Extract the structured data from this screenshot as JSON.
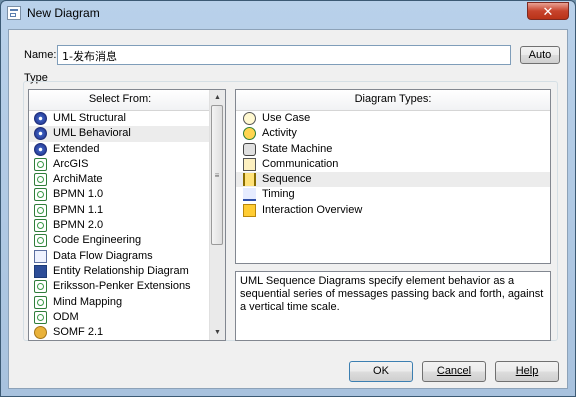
{
  "window": {
    "title": "New Diagram",
    "close_label": "✕"
  },
  "name_field": {
    "label": "Name:",
    "value": "1-发布消息"
  },
  "buttons": {
    "auto": "Auto",
    "ok": "OK",
    "cancel": "Cancel",
    "help": "Help"
  },
  "type_group": {
    "label": "Type"
  },
  "select_from": {
    "header": "Select From:",
    "selected_index": 1,
    "items": [
      {
        "label": "UML Structural",
        "icon": "uml-icon"
      },
      {
        "label": "UML Behavioral",
        "icon": "uml-icon"
      },
      {
        "label": "Extended",
        "icon": "uml-icon"
      },
      {
        "label": "ArcGIS",
        "icon": "technology-icon"
      },
      {
        "label": "ArchiMate",
        "icon": "technology-icon"
      },
      {
        "label": "BPMN 1.0",
        "icon": "technology-icon"
      },
      {
        "label": "BPMN 1.1",
        "icon": "technology-icon"
      },
      {
        "label": "BPMN 2.0",
        "icon": "technology-icon"
      },
      {
        "label": "Code Engineering",
        "icon": "technology-icon"
      },
      {
        "label": "Data Flow Diagrams",
        "icon": "dfd-icon"
      },
      {
        "label": "Entity Relationship Diagram",
        "icon": "erd-icon"
      },
      {
        "label": "Eriksson-Penker Extensions",
        "icon": "technology-icon"
      },
      {
        "label": "Mind Mapping",
        "icon": "technology-icon"
      },
      {
        "label": "ODM",
        "icon": "technology-icon"
      },
      {
        "label": "SOMF 2.1",
        "icon": "somf-icon"
      }
    ]
  },
  "diagram_types": {
    "header": "Diagram Types:",
    "selected_index": 4,
    "items": [
      {
        "label": "Use Case",
        "icon": "use-case-icon"
      },
      {
        "label": "Activity",
        "icon": "activity-icon"
      },
      {
        "label": "State Machine",
        "icon": "state-machine-icon"
      },
      {
        "label": "Communication",
        "icon": "communication-icon"
      },
      {
        "label": "Sequence",
        "icon": "sequence-icon"
      },
      {
        "label": "Timing",
        "icon": "timing-icon"
      },
      {
        "label": "Interaction Overview",
        "icon": "interaction-overview-icon"
      }
    ]
  },
  "description": "UML Sequence Diagrams specify element behavior as a sequential series of messages passing back and forth, against a vertical time scale."
}
